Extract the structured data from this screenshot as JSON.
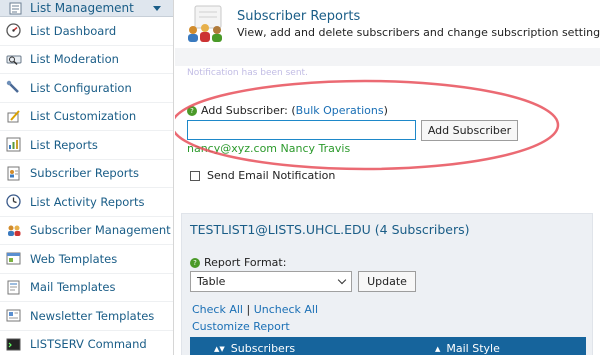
{
  "sidebar": {
    "header": "List Management",
    "items": [
      {
        "label": "List Dashboard",
        "icon": "dashboard-icon"
      },
      {
        "label": "List Moderation",
        "icon": "moderation-icon"
      },
      {
        "label": "List Configuration",
        "icon": "configuration-icon"
      },
      {
        "label": "List Customization",
        "icon": "customization-icon"
      },
      {
        "label": "List Reports",
        "icon": "reports-icon"
      },
      {
        "label": "Subscriber Reports",
        "icon": "subscriber-reports-icon"
      },
      {
        "label": "List Activity Reports",
        "icon": "activity-reports-icon"
      },
      {
        "label": "Subscriber Management",
        "icon": "subscriber-management-icon"
      },
      {
        "label": "Web Templates",
        "icon": "web-templates-icon"
      },
      {
        "label": "Mail Templates",
        "icon": "mail-templates-icon"
      },
      {
        "label": "Newsletter Templates",
        "icon": "newsletter-templates-icon"
      },
      {
        "label": "LISTSERV Command",
        "icon": "command-icon"
      }
    ]
  },
  "header": {
    "title": "Subscriber Reports",
    "subtitle": "View, add and delete subscribers and change subscription settings",
    "notice": "Notification has been sent."
  },
  "add_subscriber": {
    "label": "Add Subscriber: (",
    "bulk_link": "Bulk Operations",
    "label_close": ")",
    "input_value": "",
    "button": "Add Subscriber",
    "example": "nancy@xyz.com Nancy Travis",
    "notify_label": "Send Email Notification"
  },
  "report": {
    "title": "TESTLIST1@LISTS.UHCL.EDU (4 Subscribers)",
    "format_label": "Report Format:",
    "format_value": "Table",
    "update_button": "Update",
    "check_all": "Check All",
    "separator": " | ",
    "uncheck_all": "Uncheck All",
    "customize": "Customize Report",
    "columns": [
      "Subscribers",
      "Mail Style"
    ]
  },
  "colors": {
    "link": "#1a6fb5",
    "sidebar_text": "#1a5d87",
    "column_bar": "#16649c",
    "example_text": "#2c9a2c",
    "highlight_ellipse": "#e8505b"
  }
}
